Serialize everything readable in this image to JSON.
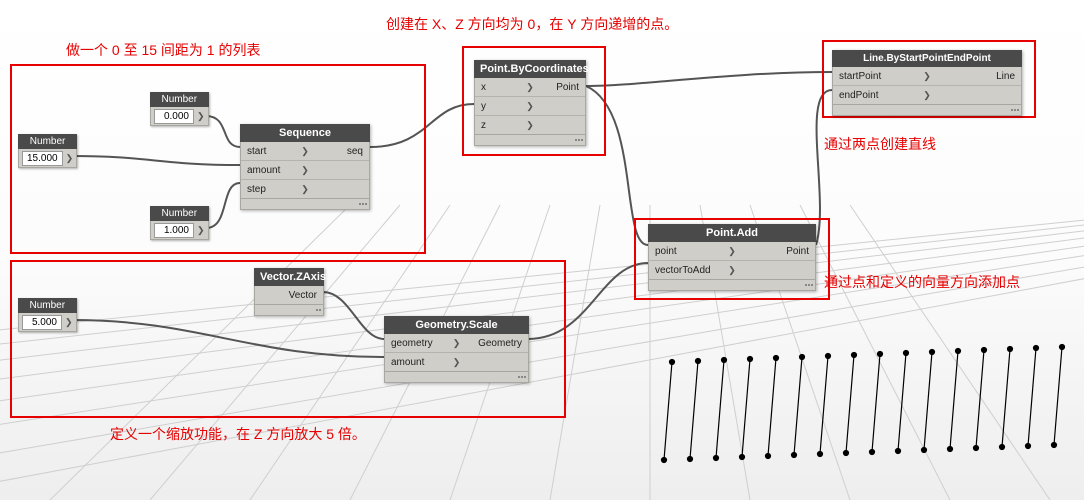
{
  "annotations": {
    "a1": "做一个 0 至 15 间距为 1 的列表",
    "a2": "创建在 X、Z 方向均为 0，在 Y 方向递增的点。",
    "a3": "定义一个缩放功能，在 Z 方向放大 5 倍。",
    "a4": "通过两点创建直线",
    "a5": "通过点和定义的向量方向添加点"
  },
  "nodes": {
    "num0": {
      "title": "Number",
      "value": "0.000"
    },
    "num15": {
      "title": "Number",
      "value": "15.000"
    },
    "num1": {
      "title": "Number",
      "value": "1.000"
    },
    "num5": {
      "title": "Number",
      "value": "5.000"
    },
    "sequence": {
      "title": "Sequence",
      "in": [
        "start",
        "amount",
        "step"
      ],
      "out": "seq"
    },
    "pointbc": {
      "title": "Point.ByCoordinates",
      "in": [
        "x",
        "y",
        "z"
      ],
      "out": "Point"
    },
    "zaxis": {
      "title": "Vector.ZAxis",
      "out": "Vector"
    },
    "gscale": {
      "title": "Geometry.Scale",
      "in": [
        "geometry",
        "amount"
      ],
      "out": "Geometry"
    },
    "padd": {
      "title": "Point.Add",
      "in": [
        "point",
        "vectorToAdd"
      ],
      "out": "Point"
    },
    "linebse": {
      "title": "Line.ByStartPointEndPoint",
      "in": [
        "startPoint",
        "endPoint"
      ],
      "out": "Line"
    }
  },
  "chevron": "❯"
}
